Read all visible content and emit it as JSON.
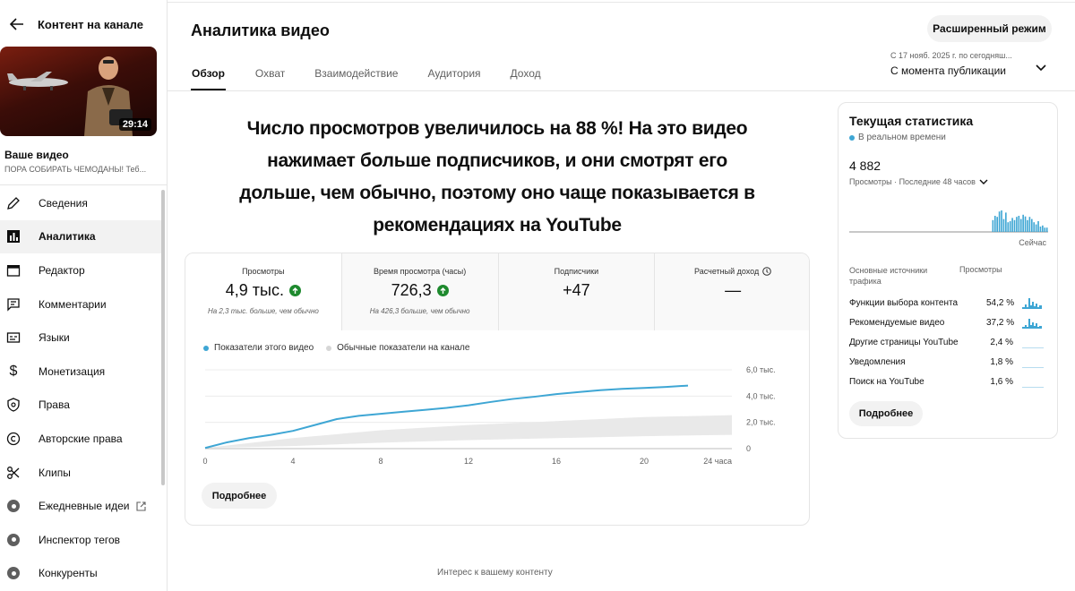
{
  "sidebar": {
    "title": "Контент на канале",
    "video_duration": "29:14",
    "your_video_label": "Ваше видео",
    "video_name": "ПОРА СОБИРАТЬ ЧЕМОДАНЫ! Теб...",
    "items": [
      {
        "label": "Сведения",
        "icon": "pencil-icon"
      },
      {
        "label": "Аналитика",
        "icon": "analytics-icon",
        "active": true
      },
      {
        "label": "Редактор",
        "icon": "clapperboard-icon"
      },
      {
        "label": "Комментарии",
        "icon": "comment-icon"
      },
      {
        "label": "Языки",
        "icon": "subtitles-icon"
      },
      {
        "label": "Монетизация",
        "icon": "dollar-icon"
      },
      {
        "label": "Права",
        "icon": "shield-icon"
      },
      {
        "label": "Авторские права",
        "icon": "copyright-icon"
      },
      {
        "label": "Клипы",
        "icon": "scissors-icon"
      },
      {
        "label": "Ежедневные идеи",
        "icon": "extension-icon",
        "external": true
      },
      {
        "label": "Инспектор тегов",
        "icon": "extension-icon"
      },
      {
        "label": "Конкуренты",
        "icon": "extension-icon"
      }
    ]
  },
  "header": {
    "title": "Аналитика видео",
    "advanced_button": "Расширенный режим",
    "tabs": [
      "Обзор",
      "Охват",
      "Взаимодействие",
      "Аудитория",
      "Доход"
    ],
    "period_small": "С 17 нояб. 2025 г. по сегодняш...",
    "period_main": "С момента публикации"
  },
  "headline": "Число просмотров увеличилось на 88 %! На это видео нажимает больше подписчиков, и они смотрят его дольше, чем обычно, поэтому оно чаще показывается в рекомендациях на YouTube",
  "metrics": [
    {
      "label": "Просмотры",
      "value": "4,9 тыс.",
      "trend_up": true,
      "note": "На 2,3 тыс. больше, чем обычно"
    },
    {
      "label": "Время просмотра (часы)",
      "value": "726,3",
      "trend_up": true,
      "note": "На 426,3 больше, чем обычно"
    },
    {
      "label": "Подписчики",
      "value": "+47",
      "trend_up": false,
      "note": ""
    },
    {
      "label": "Расчетный доход",
      "value": "—",
      "trend_up": false,
      "note": "",
      "info_icon": true
    }
  ],
  "legend": {
    "this_video": "Показатели этого видео",
    "typical": "Обычные показатели на канале"
  },
  "more_button": "Подробнее",
  "chart_data": {
    "type": "line",
    "x_unit_label": "24 часа",
    "x_ticks": [
      "0",
      "4",
      "8",
      "12",
      "16",
      "20"
    ],
    "y_ticks": [
      "0",
      "2,0 тыс.",
      "4,0 тыс.",
      "6,0 тыс."
    ],
    "ylim": [
      0,
      6000
    ],
    "xlim": [
      0,
      24
    ],
    "grid": true,
    "colors": {
      "this_video": "#3ea6d4",
      "typical_band": "#e9e9e9"
    },
    "series": [
      {
        "name": "Показатели этого видео",
        "x": [
          0,
          1,
          2,
          3,
          4,
          5,
          6,
          7,
          8,
          9,
          10,
          11,
          12,
          13,
          14,
          15,
          16,
          17,
          18,
          19,
          20,
          21,
          22
        ],
        "values": [
          50,
          480,
          800,
          1050,
          1350,
          1800,
          2250,
          2500,
          2650,
          2800,
          2950,
          3100,
          3300,
          3550,
          3780,
          3950,
          4150,
          4300,
          4450,
          4550,
          4620,
          4700,
          4800
        ]
      }
    ],
    "typical_band": {
      "x": [
        0,
        4,
        8,
        12,
        16,
        20,
        24
      ],
      "low": [
        50,
        200,
        450,
        650,
        800,
        950,
        1050
      ],
      "high": [
        50,
        800,
        1400,
        1800,
        2100,
        2400,
        2550
      ]
    }
  },
  "realtime": {
    "title": "Текущая статистика",
    "live_label": "В реальном времени",
    "count": "4 882",
    "sub_label": "Просмотры · Последние 48 часов",
    "now_label": "Сейчас",
    "bars": [
      0,
      0,
      0,
      0,
      0,
      0,
      0,
      0,
      0,
      0,
      0,
      0,
      0,
      0,
      0,
      0,
      0,
      0,
      0,
      0,
      0,
      0,
      0,
      0,
      0,
      0,
      0,
      0,
      0,
      0,
      0,
      0,
      0,
      0,
      0,
      0,
      0,
      0,
      0,
      0,
      0,
      0,
      0,
      0,
      0,
      0,
      0,
      0,
      0,
      0,
      0,
      0,
      0,
      0,
      0,
      0,
      0,
      0,
      0,
      0,
      0,
      0,
      0,
      0,
      0,
      0,
      0.55,
      0.75,
      0.7,
      0.95,
      1.0,
      0.6,
      0.9,
      0.45,
      0.5,
      0.65,
      0.55,
      0.7,
      0.75,
      0.6,
      0.8,
      0.72,
      0.55,
      0.7,
      0.6,
      0.45,
      0.35,
      0.5,
      0.25,
      0.3,
      0.2,
      0.2
    ],
    "sources_header": "Основные источники трафика",
    "views_header": "Просмотры",
    "sources": [
      {
        "name": "Функции выбора контента",
        "value": "54,2 %"
      },
      {
        "name": "Рекомендуемые видео",
        "value": "37,2 %"
      },
      {
        "name": "Другие страницы YouTube",
        "value": "2,4 %"
      },
      {
        "name": "Уведомления",
        "value": "1,8 %"
      },
      {
        "name": "Поиск на YouTube",
        "value": "1,6 %"
      }
    ],
    "more_button": "Подробнее"
  },
  "footer_section_title": "Интерес к вашему контенту"
}
